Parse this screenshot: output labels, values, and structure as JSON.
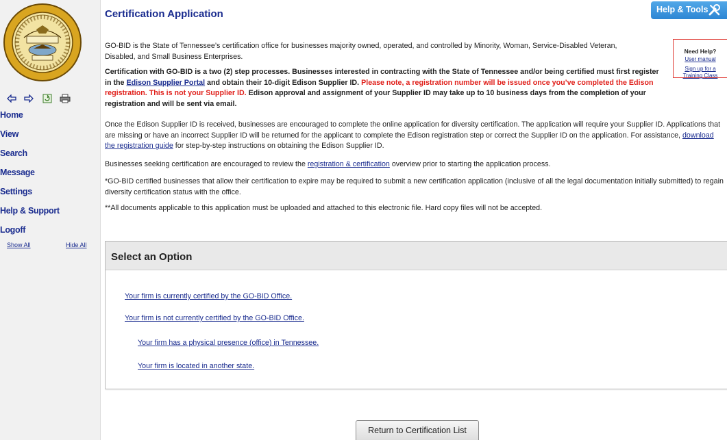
{
  "sidebar": {
    "seal_label": "state-seal",
    "toolbar": [
      {
        "name": "back-arrow-icon",
        "glyph": "⇦"
      },
      {
        "name": "forward-arrow-icon",
        "glyph": "⇨"
      },
      {
        "name": "refresh-icon",
        "glyph": "↻"
      },
      {
        "name": "print-icon",
        "glyph": "🖶"
      }
    ],
    "nav": {
      "home": "Home",
      "view": "View",
      "search": "Search",
      "message": "Message",
      "settings": "Settings",
      "help_support": "Help & Support",
      "logoff": "Logoff"
    },
    "show_all": "Show All",
    "hide_all": "Hide All"
  },
  "header": {
    "title": "Certification Application",
    "help_tools": "Help & Tools"
  },
  "need_help": {
    "title": "Need Help?",
    "user_manual": "User manual",
    "training_line1": "Sign up for a",
    "training_line2": "Training Class"
  },
  "content": {
    "intro": "GO-BID is the State of Tennessee’s certification office for businesses majority owned, operated, and controlled by Minority, Woman, Service-Disabled Veteran, Disabled, and Small Business Enterprises.",
    "step_a": "Certification with GO-BID is a two (2) step processes. Businesses interested in contracting with the State of Tennessee and/or being certified must first register in the ",
    "step_link": "Edison Supplier Portal",
    "step_b": " and obtain their 10-digit Edison Supplier ID. ",
    "step_red": "Please note, a registration number will be issued once you’ve completed the Edison registration. This is not your Supplier ID.",
    "step_c": " Edison approval and assignment of your Supplier ID may take up to 10 business days from the completion of your registration and will be sent via email.",
    "supplier_a": "Once the Edison Supplier ID is received, businesses are encouraged to complete the online application for diversity certification. The application will require your Supplier ID. Applications that are missing or have an incorrect Supplier ID will be returned for the applicant to complete the Edison registration step or correct the Supplier ID on the application. For assistance, ",
    "supplier_link": "download the registration guide",
    "supplier_b": " for step-by-step instructions on obtaining the Edison Supplier ID.",
    "review_a": "Businesses seeking certification are encouraged to review the ",
    "review_link": "registration & certification",
    "review_b": " overview prior to starting the application process.",
    "expire": "*GO-BID certified businesses that allow their certification to expire may be required to submit a new certification application (inclusive of all the legal documentation initially submitted) to regain diversity certification status with the office.",
    "documents": "**All documents applicable to this application must be uploaded and attached to this electronic file. Hard copy files will not be accepted."
  },
  "options": {
    "header": "Select an Option",
    "certified": "Your firm is currently certified by the GO-BID Office.",
    "not_certified": "Your firm is not currently certified by the GO-BID Office.",
    "physical_presence": "Your firm has a physical presence (office) in Tennessee.",
    "other_state": "Your firm is located in another state."
  },
  "return_button": "Return to Certification List",
  "colors": {
    "link_blue": "#1a2c8f",
    "alert_red": "#e0201b",
    "help_blue": "#2d86d4",
    "seal_gold": "#d9a520"
  }
}
